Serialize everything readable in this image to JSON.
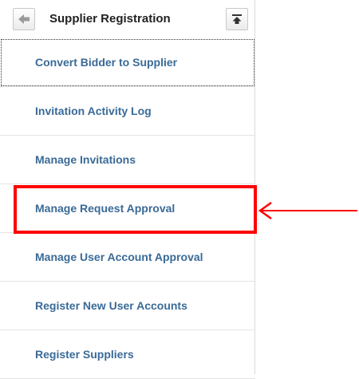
{
  "header": {
    "title": "Supplier Registration",
    "back_icon": "arrow-left-icon",
    "top_icon": "scroll-to-top-icon"
  },
  "menu": {
    "items": [
      {
        "label": "Convert Bidder to Supplier"
      },
      {
        "label": "Invitation Activity Log"
      },
      {
        "label": "Manage Invitations"
      },
      {
        "label": "Manage Request Approval"
      },
      {
        "label": "Manage User Account Approval"
      },
      {
        "label": "Register New User Accounts"
      },
      {
        "label": "Register Suppliers"
      }
    ]
  },
  "annotation": {
    "color": "#ff0000",
    "arrow_icon": "arrow-left-icon",
    "highlighted_item": "Manage Request Approval"
  },
  "colors": {
    "link": "#3a6a97",
    "title": "#222222"
  }
}
